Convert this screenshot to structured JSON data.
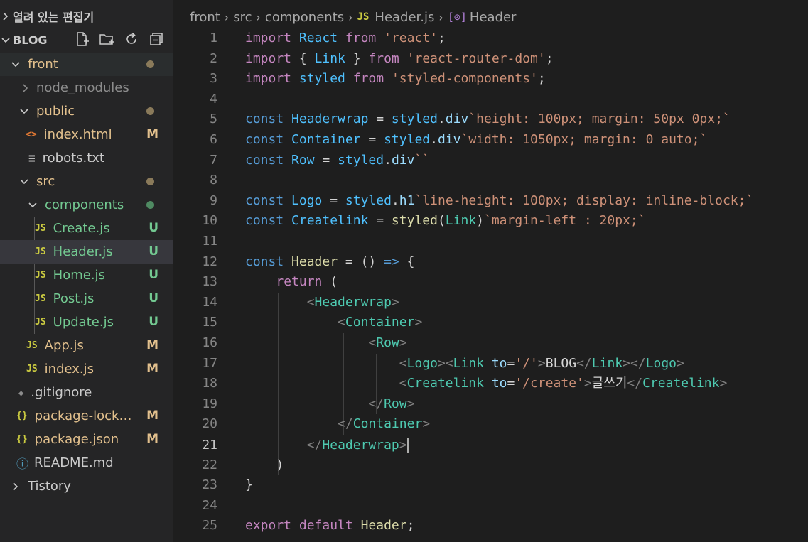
{
  "sidebar": {
    "open_editors_label": "열려 있는 편집기",
    "workspace_label": "BLOG",
    "items": [
      {
        "label": "front",
        "badge": "",
        "git_dot": true
      },
      {
        "label": "node_modules",
        "badge": ""
      },
      {
        "label": "public",
        "badge": "",
        "git_dot": true
      },
      {
        "label": "index.html",
        "badge": "M",
        "icon_text": "<>"
      },
      {
        "label": "robots.txt",
        "badge": "",
        "icon_text": "≡"
      },
      {
        "label": "src",
        "badge": "",
        "git_dot": true
      },
      {
        "label": "components",
        "badge": "",
        "git_dot": true
      },
      {
        "label": "Create.js",
        "badge": "U",
        "icon_text": "JS"
      },
      {
        "label": "Header.js",
        "badge": "U",
        "icon_text": "JS"
      },
      {
        "label": "Home.js",
        "badge": "U",
        "icon_text": "JS"
      },
      {
        "label": "Post.js",
        "badge": "U",
        "icon_text": "JS"
      },
      {
        "label": "Update.js",
        "badge": "U",
        "icon_text": "JS"
      },
      {
        "label": "App.js",
        "badge": "M",
        "icon_text": "JS"
      },
      {
        "label": "index.js",
        "badge": "M",
        "icon_text": "JS"
      },
      {
        "label": ".gitignore",
        "badge": "",
        "icon_text": "◆"
      },
      {
        "label": "package-lock.j...",
        "badge": "M",
        "icon_text": "{}"
      },
      {
        "label": "package.json",
        "badge": "M",
        "icon_text": "{}"
      },
      {
        "label": "README.md",
        "badge": "",
        "icon_text": "ⓘ"
      },
      {
        "label": "Tistory",
        "badge": ""
      }
    ]
  },
  "breadcrumb": {
    "parts": [
      "front",
      "src",
      "components"
    ],
    "file_icon": "JS",
    "file": "Header.js",
    "symbol_icon": "[⊘]",
    "symbol": "Header"
  },
  "editor": {
    "current_line": 21,
    "lines": [
      [
        [
          "import",
          "kw"
        ],
        [
          " ",
          "p"
        ],
        [
          "React",
          "v"
        ],
        [
          " ",
          "p"
        ],
        [
          "from",
          "kw"
        ],
        [
          " ",
          "p"
        ],
        [
          "'react'",
          "s"
        ],
        [
          ";",
          "p"
        ]
      ],
      [
        [
          "import",
          "kw"
        ],
        [
          " { ",
          "p"
        ],
        [
          "Link",
          "v"
        ],
        [
          " } ",
          "p"
        ],
        [
          "from",
          "kw"
        ],
        [
          " ",
          "p"
        ],
        [
          "'react-router-dom'",
          "s"
        ],
        [
          ";",
          "p"
        ]
      ],
      [
        [
          "import",
          "kw"
        ],
        [
          " ",
          "p"
        ],
        [
          "styled",
          "v"
        ],
        [
          " ",
          "p"
        ],
        [
          "from",
          "kw"
        ],
        [
          " ",
          "p"
        ],
        [
          "'styled-components'",
          "s"
        ],
        [
          ";",
          "p"
        ]
      ],
      [],
      [
        [
          "const",
          "st"
        ],
        [
          " ",
          "p"
        ],
        [
          "Headerwrap",
          "v"
        ],
        [
          " = ",
          "p"
        ],
        [
          "styled",
          "v"
        ],
        [
          ".",
          "p"
        ],
        [
          "div",
          "nm"
        ],
        [
          "`height: 100px; margin: 50px 0px;`",
          "s"
        ]
      ],
      [
        [
          "const",
          "st"
        ],
        [
          " ",
          "p"
        ],
        [
          "Container",
          "v"
        ],
        [
          " = ",
          "p"
        ],
        [
          "styled",
          "v"
        ],
        [
          ".",
          "p"
        ],
        [
          "div",
          "nm"
        ],
        [
          "`width: 1050px; margin: 0 auto;`",
          "s"
        ]
      ],
      [
        [
          "const",
          "st"
        ],
        [
          " ",
          "p"
        ],
        [
          "Row",
          "v"
        ],
        [
          " = ",
          "p"
        ],
        [
          "styled",
          "v"
        ],
        [
          ".",
          "p"
        ],
        [
          "div",
          "nm"
        ],
        [
          "``",
          "s"
        ]
      ],
      [],
      [
        [
          "const",
          "st"
        ],
        [
          " ",
          "p"
        ],
        [
          "Logo",
          "v"
        ],
        [
          " = ",
          "p"
        ],
        [
          "styled",
          "v"
        ],
        [
          ".",
          "p"
        ],
        [
          "h1",
          "nm"
        ],
        [
          "`line-height: 100px; display: inline-block;`",
          "s"
        ]
      ],
      [
        [
          "const",
          "st"
        ],
        [
          " ",
          "p"
        ],
        [
          "Createlink",
          "v"
        ],
        [
          " = ",
          "p"
        ],
        [
          "styled",
          "f"
        ],
        [
          "(",
          "p"
        ],
        [
          "Link",
          "tp"
        ],
        [
          ")",
          "p"
        ],
        [
          "`margin-left : 20px;`",
          "s"
        ]
      ],
      [],
      [
        [
          "const",
          "st"
        ],
        [
          " ",
          "p"
        ],
        [
          "Header",
          "f"
        ],
        [
          " = () ",
          "p"
        ],
        [
          "=>",
          "st"
        ],
        [
          " {",
          "p"
        ]
      ],
      [
        [
          "    ",
          "p"
        ],
        [
          "return",
          "kw"
        ],
        [
          " (",
          "p"
        ]
      ],
      [
        [
          "        ",
          "p"
        ],
        [
          "<",
          "br"
        ],
        [
          "Headerwrap",
          "tg"
        ],
        [
          ">",
          "br"
        ]
      ],
      [
        [
          "            ",
          "p"
        ],
        [
          "<",
          "br"
        ],
        [
          "Container",
          "tg"
        ],
        [
          ">",
          "br"
        ]
      ],
      [
        [
          "                ",
          "p"
        ],
        [
          "<",
          "br"
        ],
        [
          "Row",
          "tg"
        ],
        [
          ">",
          "br"
        ]
      ],
      [
        [
          "                    ",
          "p"
        ],
        [
          "<",
          "br"
        ],
        [
          "Logo",
          "tg"
        ],
        [
          "><",
          "br"
        ],
        [
          "Link",
          "tg"
        ],
        [
          " ",
          "p"
        ],
        [
          "to",
          "at"
        ],
        [
          "=",
          "p"
        ],
        [
          "'/'",
          "s"
        ],
        [
          ">",
          "br"
        ],
        [
          "BLOG",
          "tx"
        ],
        [
          "</",
          "br"
        ],
        [
          "Link",
          "tg"
        ],
        [
          "></",
          "br"
        ],
        [
          "Logo",
          "tg"
        ],
        [
          ">",
          "br"
        ]
      ],
      [
        [
          "                    ",
          "p"
        ],
        [
          "<",
          "br"
        ],
        [
          "Createlink",
          "tg"
        ],
        [
          " ",
          "p"
        ],
        [
          "to",
          "at"
        ],
        [
          "=",
          "p"
        ],
        [
          "'/create'",
          "s"
        ],
        [
          ">",
          "br"
        ],
        [
          "글쓰기",
          "tx"
        ],
        [
          "</",
          "br"
        ],
        [
          "Createlink",
          "tg"
        ],
        [
          ">",
          "br"
        ]
      ],
      [
        [
          "                ",
          "p"
        ],
        [
          "</",
          "br"
        ],
        [
          "Row",
          "tg"
        ],
        [
          ">",
          "br"
        ]
      ],
      [
        [
          "            ",
          "p"
        ],
        [
          "</",
          "br"
        ],
        [
          "Container",
          "tg"
        ],
        [
          ">",
          "br"
        ]
      ],
      [
        [
          "        ",
          "p"
        ],
        [
          "</",
          "br"
        ],
        [
          "Headerwrap",
          "tg"
        ],
        [
          ">",
          "br"
        ]
      ],
      [
        [
          "    )",
          "p"
        ]
      ],
      [
        [
          "}",
          "p"
        ]
      ],
      [],
      [
        [
          "export",
          "kw"
        ],
        [
          " ",
          "p"
        ],
        [
          "default",
          "kw"
        ],
        [
          " ",
          "p"
        ],
        [
          "Header",
          "f"
        ],
        [
          ";",
          "p"
        ]
      ]
    ]
  },
  "colors": {
    "sidebar_bg": "#252526",
    "editor_bg": "#1e1e1e",
    "modified": "#e2c08d",
    "untracked": "#73c991",
    "selected_row": "#37373d"
  }
}
